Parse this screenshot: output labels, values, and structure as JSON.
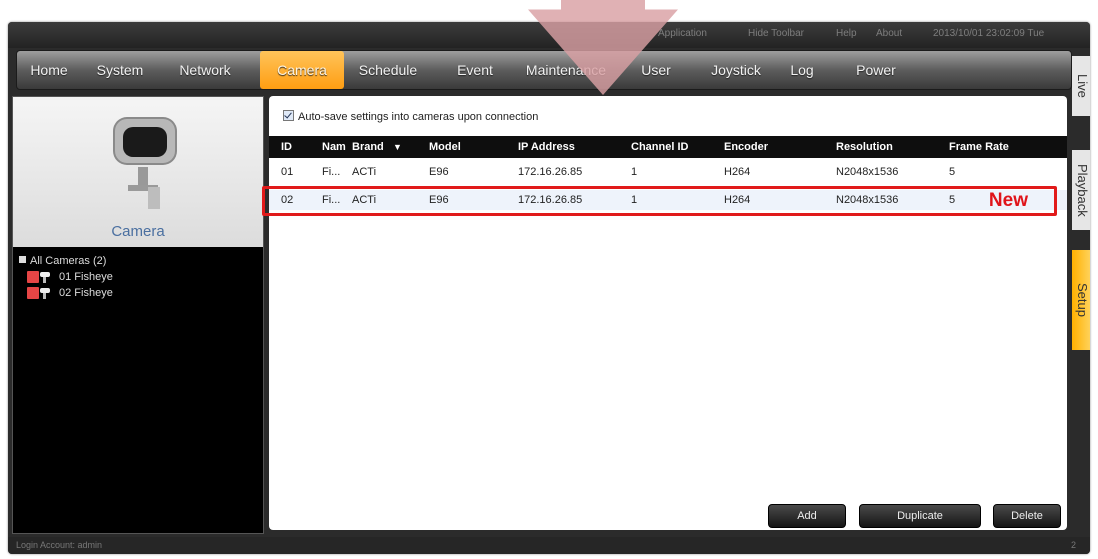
{
  "topbar": {
    "application": "Application",
    "hide_toolbar": "Hide Toolbar",
    "help": "Help",
    "about": "About",
    "datetime": "2013/10/01 23:02:09 Tue"
  },
  "menu": {
    "items": [
      "Home",
      "System",
      "Network",
      "Camera",
      "Schedule",
      "Event",
      "Maintenance",
      "User",
      "Joystick",
      "Log",
      "Power"
    ],
    "active": "Camera"
  },
  "side_tabs": [
    "Live",
    "Playback",
    "Setup"
  ],
  "left_panel": {
    "title": "Camera",
    "tree_root": "All Cameras (2)",
    "cameras": [
      "01 Fisheye",
      "02 Fisheye"
    ]
  },
  "main": {
    "autosave_label": "Auto-save settings into cameras upon connection",
    "autosave_checked": true,
    "columns": [
      "ID",
      "Nam",
      "Brand",
      "Model",
      "IP Address",
      "Channel ID",
      "Encoder",
      "Resolution",
      "Frame Rate"
    ],
    "rows": [
      [
        "01",
        "Fi...",
        "ACTi",
        "E96",
        "172.16.26.85",
        "1",
        "H264",
        "N2048x1536",
        "5"
      ],
      [
        "02",
        "Fi...",
        "ACTi",
        "E96",
        "172.16.26.85",
        "1",
        "H264",
        "N2048x1536",
        "5"
      ]
    ],
    "new_label": "New",
    "buttons": {
      "add": "Add",
      "duplicate": "Duplicate",
      "delete": "Delete"
    }
  },
  "status": {
    "login": "Login Account: admin",
    "right": "2"
  },
  "colors": {
    "accent_orange": "#ff9e12",
    "highlight_red": "#e11a1a",
    "arrow_pink": "#d9a0a4"
  }
}
